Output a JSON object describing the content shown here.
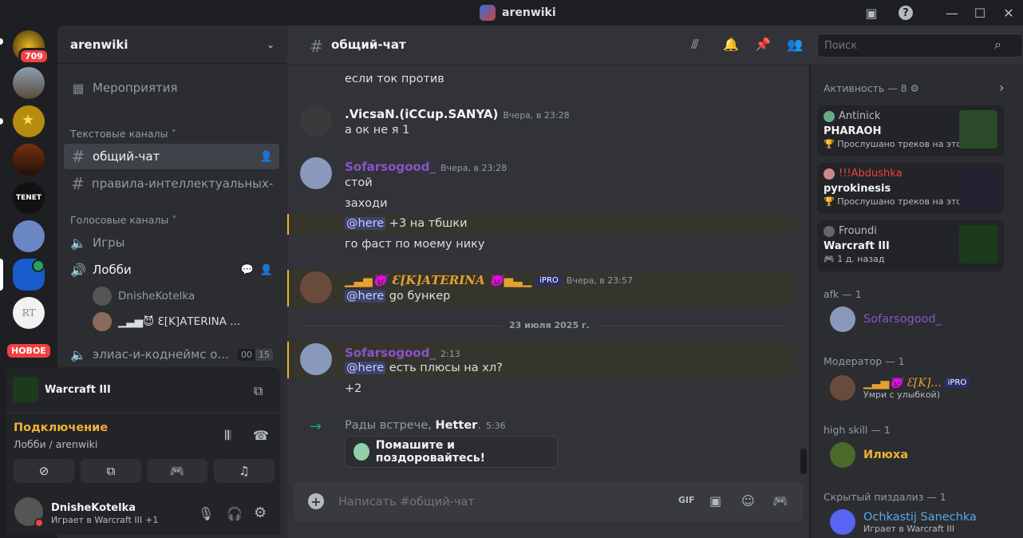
{
  "window": {
    "title": "arenwiki",
    "icons": [
      "inbox-icon",
      "help-icon",
      "minimize-icon",
      "maximize-icon",
      "close-icon"
    ]
  },
  "servers": {
    "mention_badge": "709",
    "new_badge": "НОВОЕ",
    "tenet_label": "TENET",
    "rt_label": "RT"
  },
  "sidebar": {
    "server_name": "arenwiki",
    "events": "Мероприятия",
    "text_category": "Текстовые каналы",
    "text_channels": [
      "общий-чат",
      "правила-интеллектуальных-..."
    ],
    "voice_category": "Голосовые каналы",
    "voice_games": "Игры",
    "voice_lobby": "Лобби",
    "voice_users": [
      "DnisheKotelka",
      "▁▃▅😈 Ɛ[K]ΑΤΕRΙΝΑ ..."
    ],
    "voice_other": "элиас-и-коднеймс о...",
    "voice_other_count": "00",
    "voice_other_limit": "15"
  },
  "activity_panel": {
    "game": "Warcraft III"
  },
  "voice_panel": {
    "status": "Подключение",
    "location": "Лобби / arenwiki"
  },
  "user_panel": {
    "name": "DnisheKotelka",
    "status": "Играет в Warcraft III",
    "extra": "+1"
  },
  "header": {
    "channel": "общий-чат",
    "search_placeholder": "Поиск"
  },
  "messages": [
    {
      "text": "если ток против"
    },
    {
      "author": ".VicsaN.(iCCup.SANYA)",
      "time": "Вчера, в 23:28",
      "lines": [
        "а ок не я 1"
      ]
    },
    {
      "author": "Sofarsogood_",
      "time": "Вчера, в 23:28",
      "lines": [
        "стой",
        "заходи"
      ],
      "mention_line": "+3 на тбшки",
      "last": "го фаст по моему нику"
    },
    {
      "author": "▁▃▅😈 Ɛ[K]ΑΤΕRΙΝΑ 😈▅▃▁",
      "tag": "iPRO",
      "time": "Вчера, в 23:57",
      "mention_line": "go бункер"
    },
    {
      "divider": "23 июля 2025 г."
    },
    {
      "author": "Sofarsogood_",
      "time": "2:13",
      "mention_line": "есть плюсы на хл?",
      "last": "+2"
    },
    {
      "system_prefix": "Рады встрече, ",
      "system_user": "Hetter",
      "system_suffix": ".",
      "time": "5:36",
      "wave": "Помашите и поздоровайтесь!"
    }
  ],
  "mention": "@here",
  "composer": {
    "placeholder": "Написать #общий-чат"
  },
  "members": {
    "activity_header": "Активность — 8",
    "cards": [
      {
        "user": "Antinick",
        "title": "PHARAOH",
        "sub": "Прослушано треков на этой..."
      },
      {
        "user": "!!!Abdushka",
        "title": "pyrokinesis",
        "sub": "Прослушано треков на этой..."
      },
      {
        "user": "Froundi",
        "title": "Warcraft III",
        "sub": "1 д. назад"
      }
    ],
    "afk_header": "afk — 1",
    "afk_user": "Sofarsogood_",
    "mod_header": "Модератор — 1",
    "mod_user": "▁▃▅😈 Ɛ[K]...",
    "mod_tag": "iPRO",
    "mod_status": "Умри с улыбкой)",
    "hs_header": "high skill — 1",
    "hs_user": "Илюха",
    "hidden_header": "Скрытый пиздализ — 1",
    "hidden_user": "Ochkastij Sanechka",
    "hidden_status": "Играет в Warcraft III"
  },
  "colors": {
    "accent": "#5865f2",
    "highlight": "#f0b232",
    "purple": "#8c52c8",
    "red": "#f23f43",
    "green": "#23a55a"
  }
}
